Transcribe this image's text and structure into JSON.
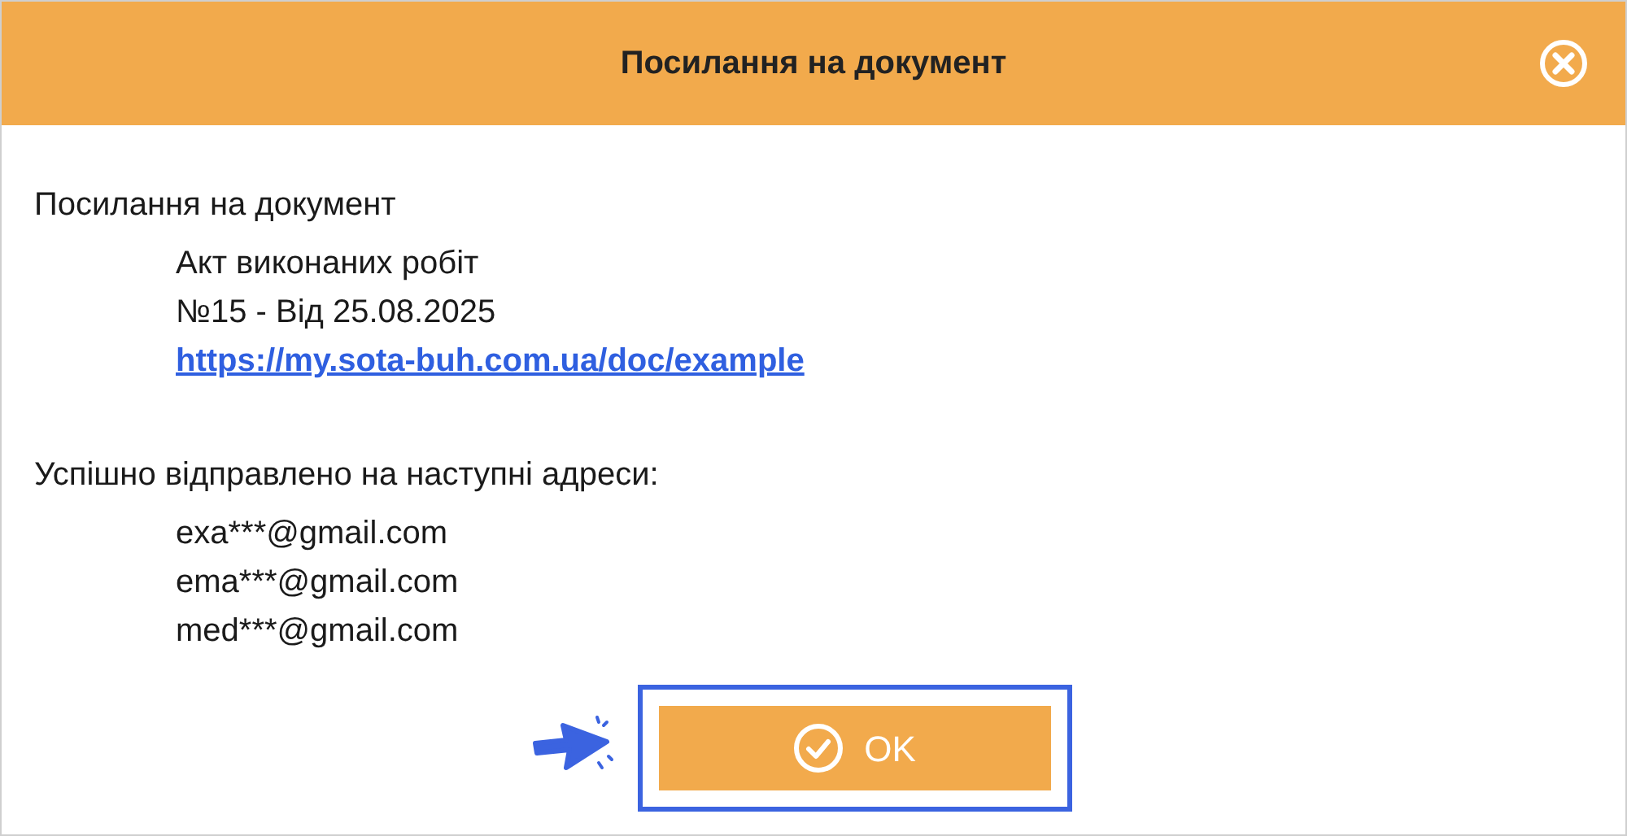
{
  "dialog": {
    "title": "Посилання на документ",
    "heading": "Посилання на документ",
    "document": [
      "Акт виконаних робіт",
      "№15 - Від 25.08.2025"
    ],
    "link": "https://my.sota-buh.com.ua/doc/example",
    "sent_label": "Успішно відправлено на наступні адреси:",
    "recipients": [
      "exa***@gmail.com",
      "ema***@gmail.com",
      "med***@gmail.com"
    ],
    "button": {
      "label": "OK",
      "highlighted": true
    }
  }
}
